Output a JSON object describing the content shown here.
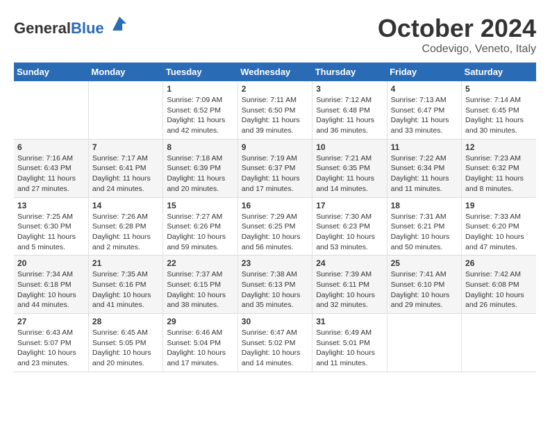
{
  "header": {
    "logo_general": "General",
    "logo_blue": "Blue",
    "month_title": "October 2024",
    "location": "Codevigo, Veneto, Italy"
  },
  "days_of_week": [
    "Sunday",
    "Monday",
    "Tuesday",
    "Wednesday",
    "Thursday",
    "Friday",
    "Saturday"
  ],
  "weeks": [
    [
      {
        "day": "",
        "sunrise": "",
        "sunset": "",
        "daylight": ""
      },
      {
        "day": "",
        "sunrise": "",
        "sunset": "",
        "daylight": ""
      },
      {
        "day": "1",
        "sunrise": "Sunrise: 7:09 AM",
        "sunset": "Sunset: 6:52 PM",
        "daylight": "Daylight: 11 hours and 42 minutes."
      },
      {
        "day": "2",
        "sunrise": "Sunrise: 7:11 AM",
        "sunset": "Sunset: 6:50 PM",
        "daylight": "Daylight: 11 hours and 39 minutes."
      },
      {
        "day": "3",
        "sunrise": "Sunrise: 7:12 AM",
        "sunset": "Sunset: 6:48 PM",
        "daylight": "Daylight: 11 hours and 36 minutes."
      },
      {
        "day": "4",
        "sunrise": "Sunrise: 7:13 AM",
        "sunset": "Sunset: 6:47 PM",
        "daylight": "Daylight: 11 hours and 33 minutes."
      },
      {
        "day": "5",
        "sunrise": "Sunrise: 7:14 AM",
        "sunset": "Sunset: 6:45 PM",
        "daylight": "Daylight: 11 hours and 30 minutes."
      }
    ],
    [
      {
        "day": "6",
        "sunrise": "Sunrise: 7:16 AM",
        "sunset": "Sunset: 6:43 PM",
        "daylight": "Daylight: 11 hours and 27 minutes."
      },
      {
        "day": "7",
        "sunrise": "Sunrise: 7:17 AM",
        "sunset": "Sunset: 6:41 PM",
        "daylight": "Daylight: 11 hours and 24 minutes."
      },
      {
        "day": "8",
        "sunrise": "Sunrise: 7:18 AM",
        "sunset": "Sunset: 6:39 PM",
        "daylight": "Daylight: 11 hours and 20 minutes."
      },
      {
        "day": "9",
        "sunrise": "Sunrise: 7:19 AM",
        "sunset": "Sunset: 6:37 PM",
        "daylight": "Daylight: 11 hours and 17 minutes."
      },
      {
        "day": "10",
        "sunrise": "Sunrise: 7:21 AM",
        "sunset": "Sunset: 6:35 PM",
        "daylight": "Daylight: 11 hours and 14 minutes."
      },
      {
        "day": "11",
        "sunrise": "Sunrise: 7:22 AM",
        "sunset": "Sunset: 6:34 PM",
        "daylight": "Daylight: 11 hours and 11 minutes."
      },
      {
        "day": "12",
        "sunrise": "Sunrise: 7:23 AM",
        "sunset": "Sunset: 6:32 PM",
        "daylight": "Daylight: 11 hours and 8 minutes."
      }
    ],
    [
      {
        "day": "13",
        "sunrise": "Sunrise: 7:25 AM",
        "sunset": "Sunset: 6:30 PM",
        "daylight": "Daylight: 11 hours and 5 minutes."
      },
      {
        "day": "14",
        "sunrise": "Sunrise: 7:26 AM",
        "sunset": "Sunset: 6:28 PM",
        "daylight": "Daylight: 11 hours and 2 minutes."
      },
      {
        "day": "15",
        "sunrise": "Sunrise: 7:27 AM",
        "sunset": "Sunset: 6:26 PM",
        "daylight": "Daylight: 10 hours and 59 minutes."
      },
      {
        "day": "16",
        "sunrise": "Sunrise: 7:29 AM",
        "sunset": "Sunset: 6:25 PM",
        "daylight": "Daylight: 10 hours and 56 minutes."
      },
      {
        "day": "17",
        "sunrise": "Sunrise: 7:30 AM",
        "sunset": "Sunset: 6:23 PM",
        "daylight": "Daylight: 10 hours and 53 minutes."
      },
      {
        "day": "18",
        "sunrise": "Sunrise: 7:31 AM",
        "sunset": "Sunset: 6:21 PM",
        "daylight": "Daylight: 10 hours and 50 minutes."
      },
      {
        "day": "19",
        "sunrise": "Sunrise: 7:33 AM",
        "sunset": "Sunset: 6:20 PM",
        "daylight": "Daylight: 10 hours and 47 minutes."
      }
    ],
    [
      {
        "day": "20",
        "sunrise": "Sunrise: 7:34 AM",
        "sunset": "Sunset: 6:18 PM",
        "daylight": "Daylight: 10 hours and 44 minutes."
      },
      {
        "day": "21",
        "sunrise": "Sunrise: 7:35 AM",
        "sunset": "Sunset: 6:16 PM",
        "daylight": "Daylight: 10 hours and 41 minutes."
      },
      {
        "day": "22",
        "sunrise": "Sunrise: 7:37 AM",
        "sunset": "Sunset: 6:15 PM",
        "daylight": "Daylight: 10 hours and 38 minutes."
      },
      {
        "day": "23",
        "sunrise": "Sunrise: 7:38 AM",
        "sunset": "Sunset: 6:13 PM",
        "daylight": "Daylight: 10 hours and 35 minutes."
      },
      {
        "day": "24",
        "sunrise": "Sunrise: 7:39 AM",
        "sunset": "Sunset: 6:11 PM",
        "daylight": "Daylight: 10 hours and 32 minutes."
      },
      {
        "day": "25",
        "sunrise": "Sunrise: 7:41 AM",
        "sunset": "Sunset: 6:10 PM",
        "daylight": "Daylight: 10 hours and 29 minutes."
      },
      {
        "day": "26",
        "sunrise": "Sunrise: 7:42 AM",
        "sunset": "Sunset: 6:08 PM",
        "daylight": "Daylight: 10 hours and 26 minutes."
      }
    ],
    [
      {
        "day": "27",
        "sunrise": "Sunrise: 6:43 AM",
        "sunset": "Sunset: 5:07 PM",
        "daylight": "Daylight: 10 hours and 23 minutes."
      },
      {
        "day": "28",
        "sunrise": "Sunrise: 6:45 AM",
        "sunset": "Sunset: 5:05 PM",
        "daylight": "Daylight: 10 hours and 20 minutes."
      },
      {
        "day": "29",
        "sunrise": "Sunrise: 6:46 AM",
        "sunset": "Sunset: 5:04 PM",
        "daylight": "Daylight: 10 hours and 17 minutes."
      },
      {
        "day": "30",
        "sunrise": "Sunrise: 6:47 AM",
        "sunset": "Sunset: 5:02 PM",
        "daylight": "Daylight: 10 hours and 14 minutes."
      },
      {
        "day": "31",
        "sunrise": "Sunrise: 6:49 AM",
        "sunset": "Sunset: 5:01 PM",
        "daylight": "Daylight: 10 hours and 11 minutes."
      },
      {
        "day": "",
        "sunrise": "",
        "sunset": "",
        "daylight": ""
      },
      {
        "day": "",
        "sunrise": "",
        "sunset": "",
        "daylight": ""
      }
    ]
  ]
}
